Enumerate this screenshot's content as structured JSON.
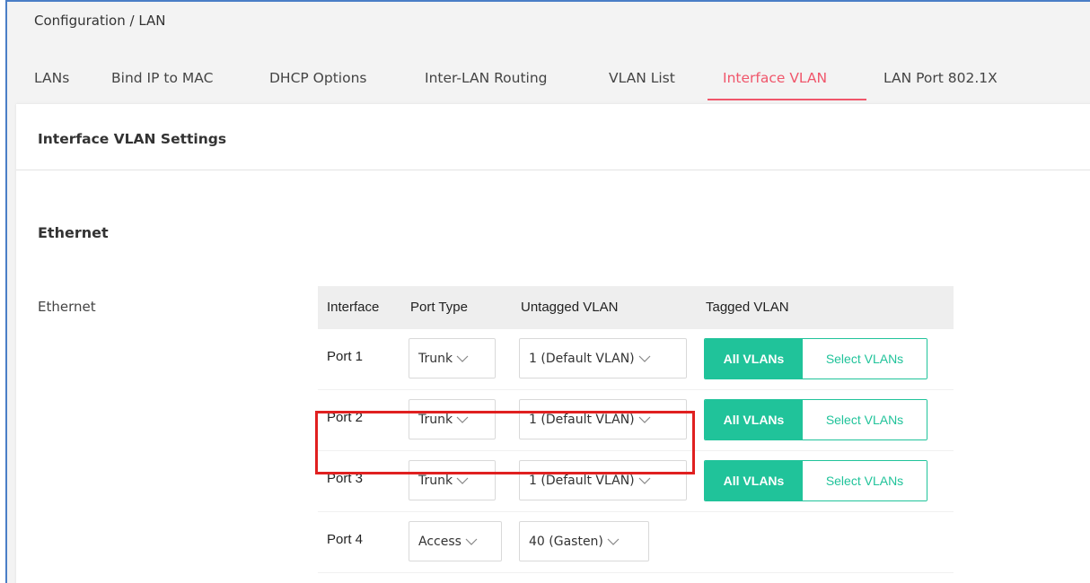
{
  "breadcrumb": "Configuration / LAN",
  "tabs": [
    {
      "label": "LANs"
    },
    {
      "label": "Bind IP to MAC"
    },
    {
      "label": "DHCP Options"
    },
    {
      "label": "Inter-LAN Routing"
    },
    {
      "label": "VLAN List"
    },
    {
      "label": "Interface VLAN",
      "active": true
    },
    {
      "label": "LAN Port 802.1X"
    }
  ],
  "card": {
    "title": "Interface VLAN Settings",
    "section_title": "Ethernet",
    "field_label": "Ethernet"
  },
  "table": {
    "headers": [
      "Interface",
      "Port Type",
      "Untagged VLAN",
      "Tagged VLAN"
    ],
    "rows": [
      {
        "interface": "Port 1",
        "port_type": "Trunk",
        "untagged_vlan": "1 (Default VLAN)",
        "tagged": {
          "all": "All VLANs",
          "select": "Select VLANs"
        }
      },
      {
        "interface": "Port 2",
        "port_type": "Trunk",
        "untagged_vlan": "1 (Default VLAN)",
        "tagged": {
          "all": "All VLANs",
          "select": "Select VLANs"
        }
      },
      {
        "interface": "Port 3",
        "port_type": "Trunk",
        "untagged_vlan": "1 (Default VLAN)",
        "tagged": {
          "all": "All VLANs",
          "select": "Select VLANs"
        }
      },
      {
        "interface": "Port 4",
        "port_type": "Access",
        "untagged_vlan": "40 (Gasten)"
      }
    ]
  },
  "colors": {
    "accent": "#f0566b",
    "tagged_green": "#20c39a",
    "highlight_red": "#e02020",
    "frame_blue": "#4a7ec6"
  },
  "icons": {
    "select_arrow": "chevron-down-icon"
  }
}
